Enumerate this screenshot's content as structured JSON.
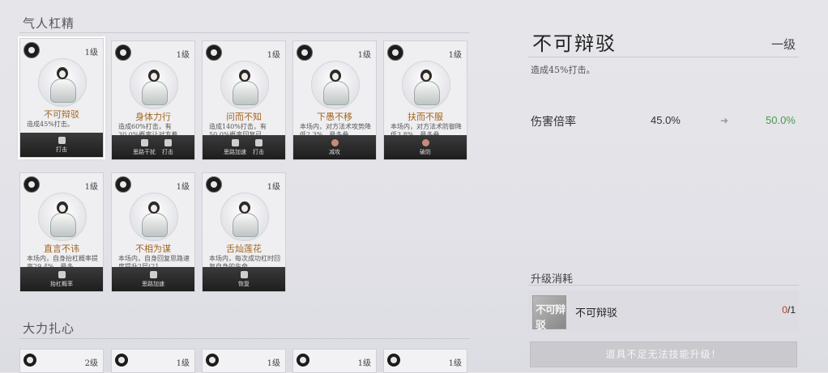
{
  "sections": {
    "first": "气人杠精",
    "second": "大力扎心"
  },
  "cards": [
    {
      "level": "1级",
      "name": "不可辩驳",
      "desc": "造成45%打击。",
      "tags": [
        {
          "icon": "attack-icon",
          "label": "打击"
        }
      ]
    },
    {
      "level": "1级",
      "name": "身体力行",
      "desc": "造成60%打击，有30.0%概率让对方着…",
      "tags": [
        {
          "icon": "mind-icon",
          "label": "思路干扰"
        },
        {
          "icon": "attack-icon",
          "label": "打击"
        }
      ]
    },
    {
      "level": "1级",
      "name": "问而不知",
      "desc": "造成140%打击，有50.0%概率回复已…",
      "tags": [
        {
          "icon": "mind-icon",
          "label": "思路加速"
        },
        {
          "icon": "attack-icon",
          "label": "打击"
        }
      ]
    },
    {
      "level": "1级",
      "name": "下愚不移",
      "desc": "本场内，对方法术攻势降低2.3%，最多叠…",
      "tags": [
        {
          "icon": "debuff-icon",
          "label": "减攻"
        }
      ]
    },
    {
      "level": "1级",
      "name": "扶而不服",
      "desc": "本场内，对方法术防御降低3.8%，最多叠…",
      "tags": [
        {
          "icon": "break-defense-icon",
          "label": "破防"
        }
      ]
    },
    {
      "level": "1级",
      "name": "直言不讳",
      "desc": "本场内，自身抬杠概率提高29.4%，最多…",
      "tags": [
        {
          "icon": "rate-icon",
          "label": "抬杠概率"
        }
      ]
    },
    {
      "level": "1级",
      "name": "不相为谋",
      "desc": "本场内，自身回复思路速度提升2层(21.…",
      "tags": [
        {
          "icon": "mind-icon",
          "label": "思路加速"
        }
      ]
    },
    {
      "level": "1级",
      "name": "舌灿莲花",
      "desc": "本场内，每次成功杠时回复自身的生命。",
      "tags": [
        {
          "icon": "heal-icon",
          "label": "恢复"
        }
      ]
    }
  ],
  "mini_cards": [
    {
      "level": "2级"
    },
    {
      "level": "1级"
    },
    {
      "level": "1级"
    },
    {
      "level": "1级"
    },
    {
      "level": "1级"
    }
  ],
  "detail": {
    "title": "不可辩驳",
    "level": "一级",
    "desc": "造成45%打击。",
    "stat_label": "伤害倍率",
    "stat_old": "45.0%",
    "stat_new": "50.0%"
  },
  "cost": {
    "title": "升级消耗",
    "icon_text": "不可辩驳",
    "item_name": "不可辩驳",
    "have": "0",
    "need": "/1"
  },
  "upgrade_button": "道具不足无法技能升级！"
}
